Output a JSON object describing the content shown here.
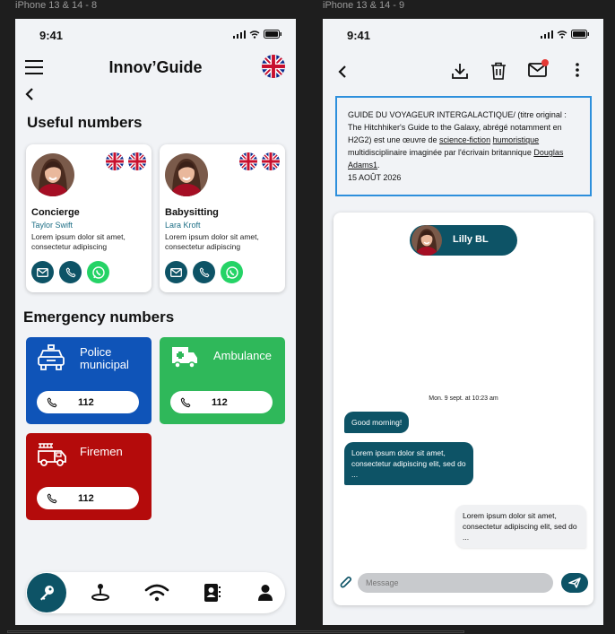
{
  "frames": {
    "left_label": "iPhone 13 & 14 - 8",
    "right_label": "iPhone 13 & 14 - 9"
  },
  "status": {
    "time": "9:41"
  },
  "guide": {
    "title": "Innov’Guide",
    "useful_title": "Useful numbers",
    "emergency_title": "Emergency numbers",
    "contacts": [
      {
        "role": "Concierge",
        "name": "Taylor Swift",
        "desc": "Lorem ipsum dolor sit amet, consectetur adipiscing"
      },
      {
        "role": "Babysitting",
        "name": "Lara Kroft",
        "desc": "Lorem ipsum dolor sit amet, consectetur adipiscing"
      }
    ],
    "emergency": [
      {
        "label": "Police municipal",
        "number": "112",
        "color": "#0f54b8"
      },
      {
        "label": "Ambulance",
        "number": "112",
        "color": "#2fb85a"
      },
      {
        "label": "Firemen",
        "number": "112",
        "color": "#b40b0b"
      }
    ]
  },
  "chat": {
    "info": {
      "line_start": "GUIDE DU VOYAGEUR INTERGALACTIQUE/ (titre original : The Hitchhiker's Guide to the Galaxy, abrégé notamment en H2G2) est une œuvre de ",
      "link1": "science-fiction",
      "space": " ",
      "link2": "humoristique",
      "mid": " multidisciplinaire imaginée par l'écrivain britannique ",
      "link3": "Douglas Adams1",
      "end": ".",
      "date": "15 AOÛT 2026"
    },
    "user": "Lilly BL",
    "date": "Mon. 9 sept. at 10:23 am",
    "messages": [
      {
        "text": "Good morning!",
        "dir": "out"
      },
      {
        "text": "Lorem ipsum dolor sit amet, consectetur adipiscing elit, sed do ...",
        "dir": "out"
      },
      {
        "text": "Lorem ipsum dolor sit amet, consectetur adipiscing elit, sed do ...",
        "dir": "in"
      }
    ],
    "placeholder": "Message"
  },
  "colors": {
    "primary": "#0d5366",
    "whatsapp": "#25d366",
    "accent_border": "#2d8fdc",
    "notification": "#e53935"
  },
  "icons": [
    "menu-icon",
    "uk-flag-icon",
    "back-arrow-icon",
    "mail-icon",
    "phone-icon",
    "whatsapp-icon",
    "police-car-icon",
    "ambulance-icon",
    "fire-truck-icon",
    "key-icon",
    "location-icon",
    "wifi-icon",
    "contacts-icon",
    "user-icon",
    "download-icon",
    "trash-icon",
    "notification-mail-icon",
    "more-icon",
    "attach-icon",
    "send-icon"
  ]
}
